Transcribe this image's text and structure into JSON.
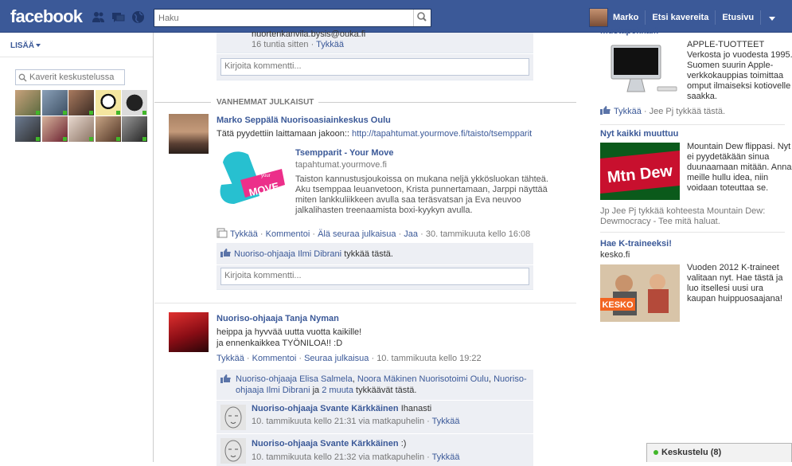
{
  "topbar": {
    "logo": "facebook",
    "search_placeholder": "Haku",
    "user_name": "Marko",
    "find_friends": "Etsi kavereita",
    "home": "Etusivu"
  },
  "left": {
    "more_label": "LISÄÄ",
    "chat_search_placeholder": "Kaverit keskustelussa"
  },
  "feed": {
    "prev_post": {
      "fragment": "nuortenkanvila.bysis@ouka.fi",
      "time": "16 tuntia sitten",
      "like": "Tykkää",
      "comment_placeholder": "Kirjoita kommentti..."
    },
    "older_posts_label": "VANHEMMAT JULKAISUT",
    "post1": {
      "author": "Marko Seppälä Nuorisoasiainkeskus Oulu",
      "text": "Tätä pyydettiin laittamaan jakoon::",
      "url": "http://tapahtumat.yourmove.fi/taisto/tsempparit",
      "attachment": {
        "title": "Tsempparit - Your Move",
        "domain": "tapahtumat.yourmove.fi",
        "logo_text": "MOVE",
        "logo_small": "your",
        "description": "Taiston kannustusjoukoissa on mukana neljä ykkösluokan tähteä. Aku tsemppaa leuanvetoon, Krista punnertamaan, Jarppi näyttää miten lankkuliikkeen avulla saa teräsvatsan ja Eva neuvoo jalkalihasten treenaamista boxi-kyykyn avulla."
      },
      "actions": {
        "like": "Tykkää",
        "comment": "Kommentoi",
        "unfollow": "Älä seuraa julkaisua",
        "share": "Jaa",
        "time": "30. tammikuuta kello 16:08"
      },
      "likes": {
        "who": "Nuoriso-ohjaaja Ilmi Dibrani",
        "suffix": "tykkää tästä."
      },
      "comment_placeholder": "Kirjoita kommentti..."
    },
    "post2": {
      "author": "Nuoriso-ohjaaja Tanja Nyman",
      "text_line1": "heippa ja hyvvää uutta vuotta kaikille!",
      "text_line2": "ja ennenkaikkea TYÖNILOA!! :D",
      "actions": {
        "like": "Tykkää",
        "comment": "Kommentoi",
        "follow": "Seuraa julkaisua",
        "time": "10. tammikuuta kello 19:22"
      },
      "likes": {
        "name1": "Nuoriso-ohjaaja Elisa Salmela",
        "name2": "Noora Mäkinen Nuorisotoimi Oulu",
        "name3": "Nuoriso-ohjaaja Ilmi Dibrani",
        "and": "ja",
        "more": "2 muuta",
        "suffix": "tykkäävät tästä."
      },
      "comments": [
        {
          "author": "Nuoriso-ohjaaja Svante Kärkkäinen",
          "text": "Ihanasti",
          "time": "10. tammikuuta kello 21:31 via matkapuhelin",
          "like": "Tykkää"
        },
        {
          "author": "Nuoriso-ohjaaja Svante Kärkkäinen",
          "text": ":)",
          "time": "10. tammikuuta kello 21:32 via matkapuhelin",
          "like": "Tykkää"
        }
      ]
    }
  },
  "ads": [
    {
      "title": "mustapekka.fi",
      "body": "APPLE-TUOTTEET Verkosta jo vuodesta 1995. Suomen suurin Apple-verkkokauppias toimittaa omput ilmaiseksi kotiovelle saakka.",
      "like": "Tykkää",
      "social": "Jee Pj tykkää tästä."
    },
    {
      "title": "Nyt kaikki muuttuu",
      "image_text": "Mtn Dew",
      "body": "Mountain Dew flippasi. Nyt ei pyydetäkään sinua duunaamaan mitään. Anna meille hullu idea, niin voidaan toteuttaa se.",
      "social": "Jp Jee Pj tykkää kohteesta Mountain Dew: Dewmocracy - Tee mitä haluat."
    },
    {
      "title": "Hae K-traineeksi!",
      "domain": "kesko.fi",
      "image_text": "KESKO",
      "body": "Vuoden 2012 K-traineet valitaan nyt. Hae tästä ja luo itsellesi uusi ura kaupan huippuosaajana!"
    }
  ],
  "chatbar": {
    "label": "Keskustelu (8)"
  },
  "colors": {
    "brand": "#3b5998",
    "online": "#42b72a"
  }
}
